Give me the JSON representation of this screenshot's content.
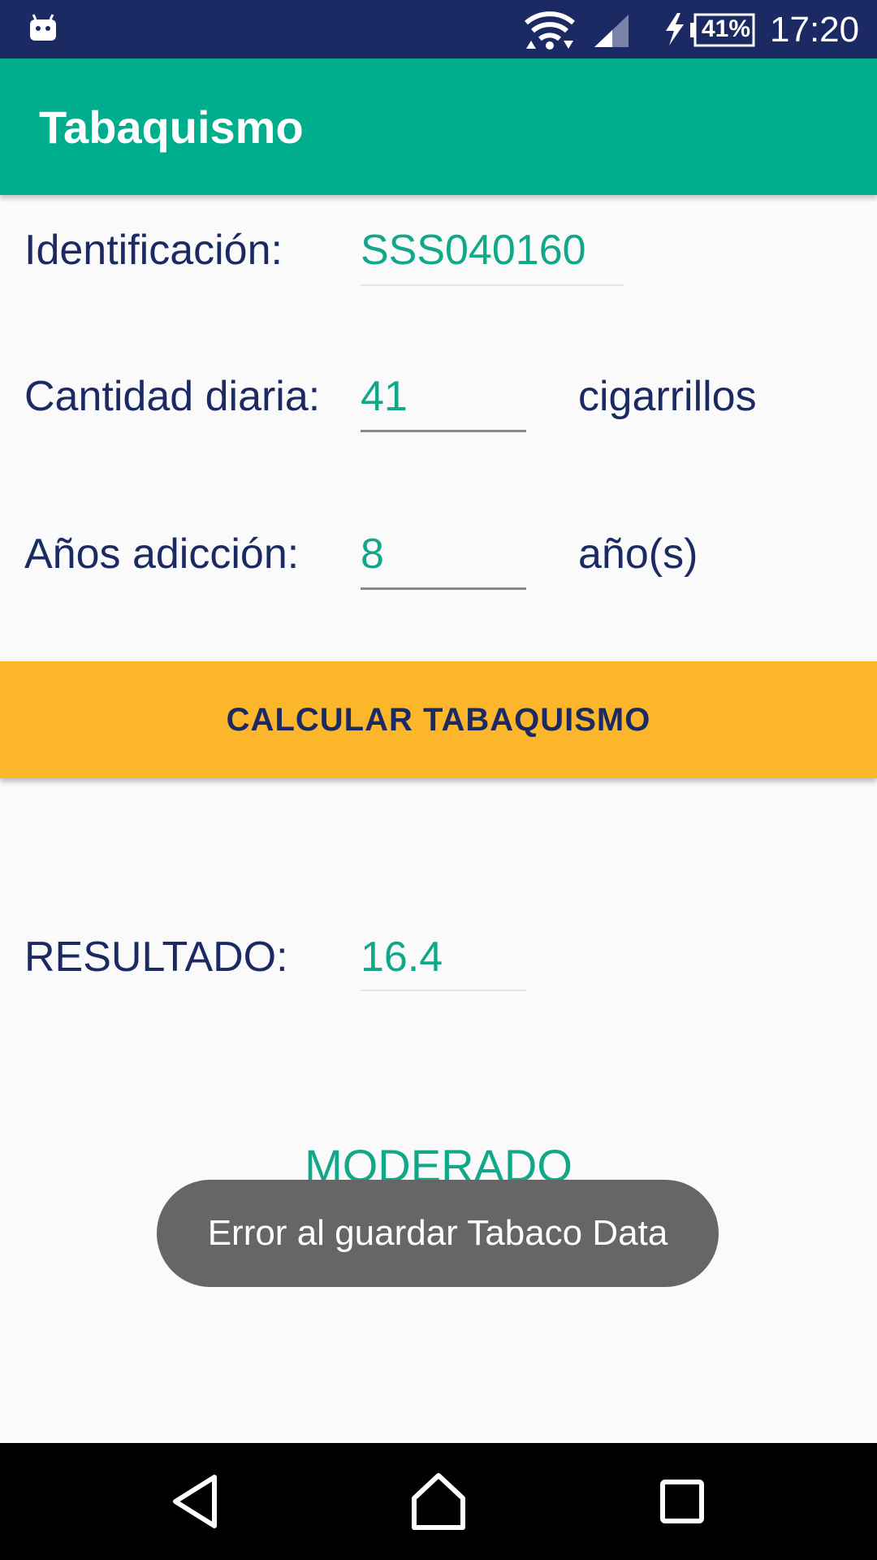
{
  "status_bar": {
    "time": "17:20",
    "battery": "41%",
    "icons": [
      "android-notification-icon",
      "wifi-icon",
      "cell-signal-icon",
      "charging-icon",
      "battery-icon"
    ]
  },
  "app_bar": {
    "title": "Tabaquismo"
  },
  "form": {
    "identification": {
      "label": "Identificación:",
      "value": "SSS040160"
    },
    "daily_amount": {
      "label": "Cantidad diaria:",
      "value": "41",
      "unit": "cigarrillos"
    },
    "years_addiction": {
      "label": "Años adicción:",
      "value": "8",
      "unit": "año(s)"
    }
  },
  "calculate_button": {
    "label": "CALCULAR TABAQUISMO"
  },
  "result": {
    "label": "RESULTADO:",
    "value": "16.4",
    "classification": "MODERADO"
  },
  "toast": {
    "message": "Error al guardar Tabaco Data"
  },
  "nav_bar": {
    "icons": [
      "back-icon",
      "home-icon",
      "recents-icon"
    ]
  },
  "colors": {
    "status_bar": "#1b2a63",
    "app_bar": "#00ad8c",
    "accent": "#11a88a",
    "button": "#fbb62b",
    "text": "#1b2a63"
  }
}
